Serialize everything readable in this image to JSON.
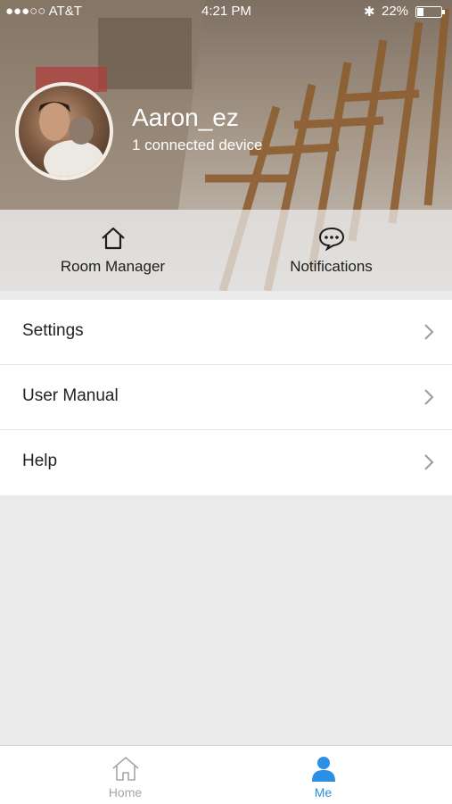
{
  "status_bar": {
    "carrier": "●●●○○ AT&T",
    "time": "4:21 PM",
    "battery": "22%"
  },
  "profile": {
    "username": "Aaron_ez",
    "subtitle": "1 connected device"
  },
  "quick_actions": [
    {
      "label": "Room Manager",
      "icon": "home-outline-icon"
    },
    {
      "label": "Notifications",
      "icon": "chat-bubble-icon"
    }
  ],
  "menu": [
    {
      "label": "Settings"
    },
    {
      "label": "User Manual"
    },
    {
      "label": "Help"
    }
  ],
  "tabbar": [
    {
      "label": "Home",
      "icon": "home-icon",
      "active": false
    },
    {
      "label": "Me",
      "icon": "person-icon",
      "active": true
    }
  ],
  "colors": {
    "accent": "#2b8fe3",
    "inactive": "#a6a6a6"
  }
}
